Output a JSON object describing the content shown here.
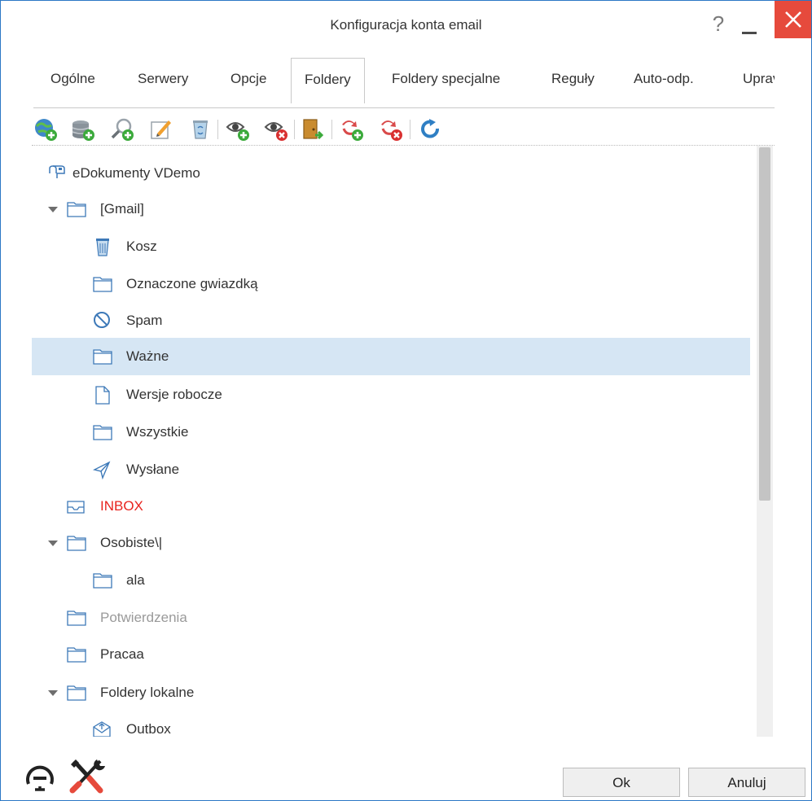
{
  "window": {
    "title": "Konfiguracja konta email",
    "help_label": "?"
  },
  "tabs": [
    {
      "label": "Ogólne",
      "active": false
    },
    {
      "label": "Serwery",
      "active": false
    },
    {
      "label": "Opcje",
      "active": false
    },
    {
      "label": "Foldery",
      "active": true
    },
    {
      "label": "Foldery specjalne",
      "active": false
    },
    {
      "label": "Reguły",
      "active": false
    },
    {
      "label": "Auto-odp.",
      "active": false
    },
    {
      "label": "Uprav",
      "active": false
    }
  ],
  "toolbar": {
    "buttons": [
      {
        "icon": "globe-add-icon"
      },
      {
        "icon": "database-add-icon"
      },
      {
        "icon": "search-user-icon"
      },
      {
        "icon": "edit-icon"
      },
      {
        "icon": "delete-bin-icon"
      },
      {
        "icon": "subscribe-icon"
      },
      {
        "icon": "unsubscribe-icon"
      },
      {
        "icon": "move-folder-icon"
      },
      {
        "icon": "add-rule-icon"
      },
      {
        "icon": "remove-rule-icon"
      },
      {
        "icon": "refresh-icon"
      }
    ]
  },
  "tree": {
    "items": [
      {
        "label": "eDokumenty VDemo",
        "icon": "account-icon",
        "level": 0,
        "expander": false
      },
      {
        "label": "[Gmail]",
        "icon": "folder-icon",
        "level": 1,
        "expander": true
      },
      {
        "label": "Kosz",
        "icon": "trash-icon",
        "level": 2,
        "expander": false
      },
      {
        "label": "Oznaczone gwiazdką",
        "icon": "folder-icon",
        "level": 2,
        "expander": false
      },
      {
        "label": "Spam",
        "icon": "spam-icon",
        "level": 2,
        "expander": false
      },
      {
        "label": "Ważne",
        "icon": "folder-icon",
        "level": 2,
        "expander": false,
        "selected": true
      },
      {
        "label": "Wersje robocze",
        "icon": "draft-icon",
        "level": 2,
        "expander": false
      },
      {
        "label": "Wszystkie",
        "icon": "folder-icon",
        "level": 2,
        "expander": false
      },
      {
        "label": "Wysłane",
        "icon": "sent-icon",
        "level": 2,
        "expander": false
      },
      {
        "label": "INBOX",
        "icon": "inbox-icon",
        "level": 1,
        "expander": false,
        "style": "red"
      },
      {
        "label": "Osobiste\\|",
        "icon": "folder-icon",
        "level": 1,
        "expander": true
      },
      {
        "label": "ala",
        "icon": "folder-icon",
        "level": 2,
        "expander": false
      },
      {
        "label": "Potwierdzenia",
        "icon": "folder-icon",
        "level": 1,
        "expander": false,
        "style": "muted"
      },
      {
        "label": "Pracaa",
        "icon": "folder-icon",
        "level": 1,
        "expander": false
      },
      {
        "label": "Foldery lokalne",
        "icon": "folder-icon",
        "level": 1,
        "expander": true
      },
      {
        "label": "Outbox",
        "icon": "outbox-icon",
        "level": 2,
        "expander": false
      }
    ]
  },
  "footer": {
    "ok_label": "Ok",
    "cancel_label": "Anuluj",
    "icons": [
      "dashboard-icon",
      "tools-icon"
    ]
  },
  "colors": {
    "window_border": "#2b78c5",
    "close_button": "#e64a3c",
    "selection": "#d6e6f4",
    "inbox_red": "#e8231e",
    "folder_outline": "#3d79b8"
  }
}
